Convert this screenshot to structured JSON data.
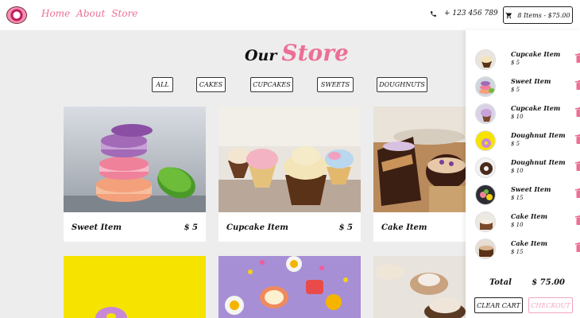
{
  "nav": {
    "links": [
      "Home",
      "About",
      "Store"
    ],
    "phone": "+ 123 456 789",
    "cart_summary": "8 Items - $75.00"
  },
  "store": {
    "title_prefix": "Our",
    "title_main": "Store",
    "filters": [
      "ALL",
      "CAKES",
      "CUPCAKES",
      "SWEETS",
      "DOUGHNUTS"
    ]
  },
  "products": [
    {
      "name": "Sweet Item",
      "price": "$ 5"
    },
    {
      "name": "Cupcake Item",
      "price": "$ 5"
    },
    {
      "name": "Cake Item",
      "price": ""
    }
  ],
  "cart": {
    "items": [
      {
        "name": "Cupcake Item",
        "price": "$ 5"
      },
      {
        "name": "Sweet Item",
        "price": "$ 5"
      },
      {
        "name": "Cupcake Item",
        "price": "$ 10"
      },
      {
        "name": "Doughnut Item",
        "price": "$ 5"
      },
      {
        "name": "Doughnut Item",
        "price": "$ 10"
      },
      {
        "name": "Sweet Item",
        "price": "$ 15"
      },
      {
        "name": "Cake Item",
        "price": "$ 10"
      },
      {
        "name": "Cake Item",
        "price": "$ 15"
      }
    ],
    "total_label": "Total",
    "total_value": "$ 75.00",
    "clear_label": "CLEAR CART",
    "checkout_label": "CHECKOUT"
  },
  "colors": {
    "accent": "#ec6f95",
    "background": "#ededed"
  },
  "icons": {
    "phone": "phone-icon",
    "cart": "shopping-cart-icon",
    "trash": "trash-icon",
    "logo": "doughnut-logo-icon"
  }
}
